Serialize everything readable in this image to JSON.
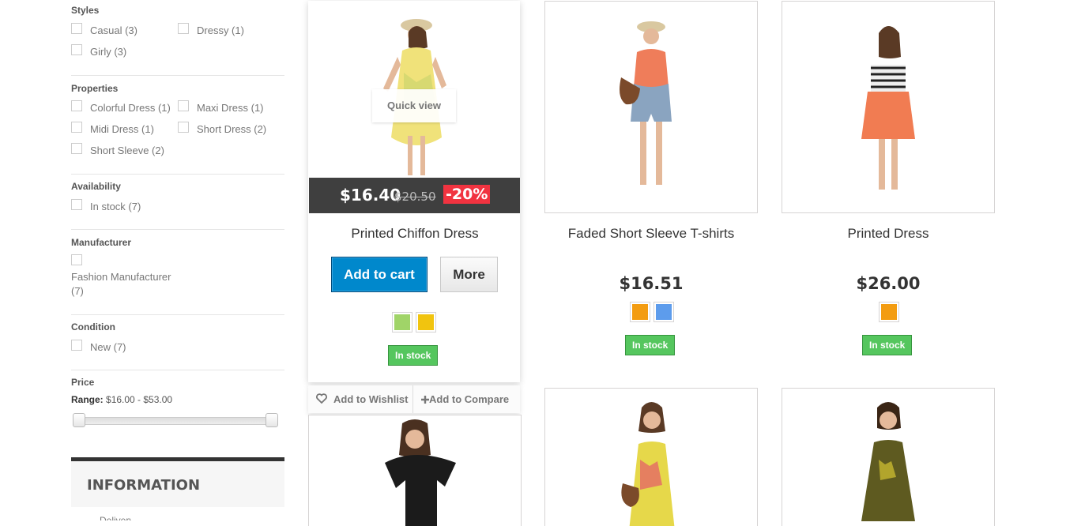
{
  "filters": {
    "styles": {
      "title": "Styles",
      "options": [
        "Casual (3)",
        "Dressy (1)",
        "Girly (3)"
      ]
    },
    "properties": {
      "title": "Properties",
      "options": [
        "Colorful Dress (1)",
        "Maxi Dress (1)",
        "Midi Dress (1)",
        "Short Dress (2)",
        "Short Sleeve (2)"
      ]
    },
    "availability": {
      "title": "Availability",
      "options": [
        "In stock (7)"
      ]
    },
    "manufacturer": {
      "title": "Manufacturer",
      "options": [
        "Fashion Manufacturer",
        "(7)"
      ]
    },
    "condition": {
      "title": "Condition",
      "options": [
        "New (7)"
      ]
    },
    "price": {
      "title": "Price",
      "range_label": "Range:",
      "range_value": "$16.00 - $53.00"
    }
  },
  "information": {
    "title": "INFORMATION",
    "first_item": "Delivery"
  },
  "products": [
    {
      "name": "Printed Chiffon Dress",
      "price": "$16.40",
      "old_price": "$20.50",
      "discount": "-20%",
      "quick_view": "Quick view",
      "add_to_cart": "Add to cart",
      "more": "More",
      "colors": [
        "#a0d468",
        "#f1c40f"
      ],
      "stock": "In stock",
      "wishlist": "Add to Wishlist",
      "compare": "Add to Compare"
    },
    {
      "name": "Faded Short Sleeve T-shirts",
      "price": "$16.51",
      "colors": [
        "#f39c11",
        "#5d9cec"
      ],
      "stock": "In stock"
    },
    {
      "name": "Printed Dress",
      "price": "$26.00",
      "colors": [
        "#f39c11"
      ],
      "stock": "In stock"
    }
  ],
  "icons": [
    "heart-icon",
    "plus-icon"
  ]
}
